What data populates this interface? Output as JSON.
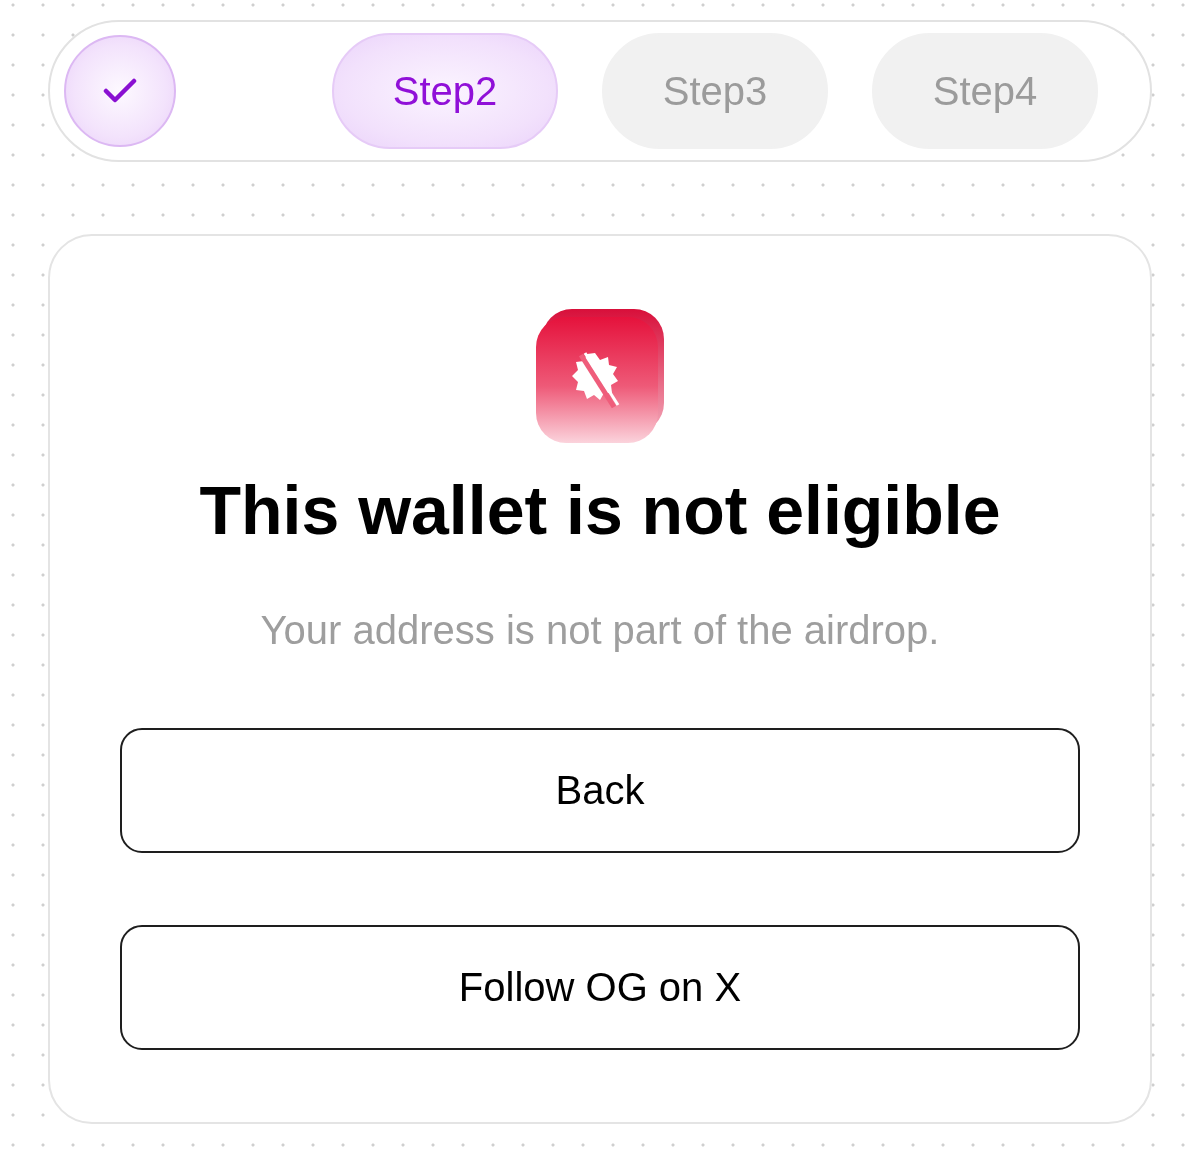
{
  "steps": [
    {
      "completed": true,
      "selected": false
    },
    {
      "label": "Step2",
      "completed": false,
      "selected": true
    },
    {
      "label": "Step3",
      "completed": false,
      "selected": false
    },
    {
      "label": "Step4",
      "completed": false,
      "selected": false
    }
  ],
  "result": {
    "title": "This wallet is not eligible",
    "message": "Your address is not part of the airdrop."
  },
  "buttons": [
    {
      "label": "Back"
    },
    {
      "label": "Follow OG on X"
    }
  ]
}
